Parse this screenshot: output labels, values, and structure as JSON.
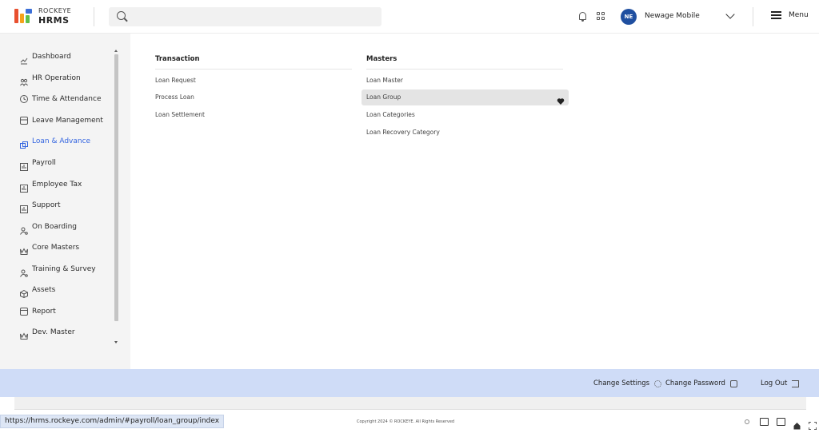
{
  "brand": {
    "line1": "ROCKEYE",
    "line2": "HRMS"
  },
  "search": {
    "placeholder": ""
  },
  "user": {
    "initials": "NE",
    "name": "Newage Mobile"
  },
  "header": {
    "menu_label": "Menu"
  },
  "sidebar": {
    "items": [
      {
        "label": "Dashboard",
        "icon": "dashboard-icon"
      },
      {
        "label": "HR Operation",
        "icon": "people-icon"
      },
      {
        "label": "Time & Attendance",
        "icon": "clock-icon"
      },
      {
        "label": "Leave Management",
        "icon": "calendar-icon"
      },
      {
        "label": "Loan & Advance",
        "icon": "loan-icon",
        "active": true
      },
      {
        "label": "Payroll",
        "icon": "payroll-icon"
      },
      {
        "label": "Employee Tax",
        "icon": "tax-icon"
      },
      {
        "label": "Support",
        "icon": "support-icon"
      },
      {
        "label": "On Boarding",
        "icon": "onboarding-icon"
      },
      {
        "label": "Core Masters",
        "icon": "crown-icon"
      },
      {
        "label": "Training & Survey",
        "icon": "training-icon"
      },
      {
        "label": "Assets",
        "icon": "box-icon"
      },
      {
        "label": "Report",
        "icon": "report-icon"
      },
      {
        "label": "Dev. Master",
        "icon": "crown-icon"
      }
    ]
  },
  "submenu": {
    "transaction": {
      "title": "Transaction",
      "links": [
        "Loan Request",
        "Process Loan",
        "Loan Settlement"
      ]
    },
    "masters": {
      "title": "Masters",
      "links": [
        "Loan Master",
        "Loan Group",
        "Loan Categories",
        "Loan Recovery Category"
      ],
      "highlighted": "Loan Group"
    }
  },
  "footer": {
    "change_settings": "Change Settings",
    "change_password": "Change Password",
    "log_out": "Log Out",
    "copyright": "Copyright 2024 © ROCKEYE. All Rights Reserved"
  },
  "status": {
    "url": "https://hrms.rockeye.com/admin/#payroll/loan_group/index"
  },
  "colors": {
    "accent": "#3465e0",
    "footer_bg": "#cfdcf7",
    "avatar_bg": "#1f4fa0"
  }
}
